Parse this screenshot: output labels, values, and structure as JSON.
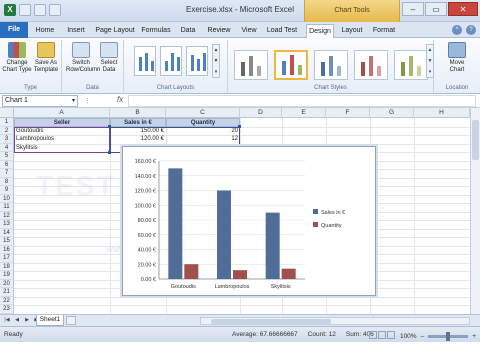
{
  "window": {
    "title": "Exercise.xlsx - Microsoft Excel",
    "context_tab_group": "Chart Tools"
  },
  "controls": {
    "minimize": "–",
    "restore": "▭",
    "close": "✕"
  },
  "tabs": [
    {
      "label": "File"
    },
    {
      "label": "Home"
    },
    {
      "label": "Insert"
    },
    {
      "label": "Page Layout"
    },
    {
      "label": "Formulas"
    },
    {
      "label": "Data"
    },
    {
      "label": "Review"
    },
    {
      "label": "View"
    },
    {
      "label": "Load Test"
    },
    {
      "label": "Design"
    },
    {
      "label": "Layout"
    },
    {
      "label": "Format"
    }
  ],
  "ribbon": {
    "change_chart_type": "Change Chart Type",
    "save_as_template": "Save As Template",
    "group_type": "Type",
    "switch_row_column": "Switch Row/Column",
    "select_data": "Select Data",
    "group_data": "Data",
    "group_chart_layouts": "Chart Layouts",
    "group_chart_styles": "Chart Styles",
    "move_chart": "Move Chart",
    "group_location": "Location"
  },
  "formula_bar": {
    "name_box": "Chart 1",
    "fx": "fx",
    "value": ""
  },
  "columns": [
    "A",
    "B",
    "C",
    "D",
    "E",
    "F",
    "G",
    "H"
  ],
  "rows": [
    "1",
    "2",
    "3",
    "4",
    "5",
    "6",
    "7",
    "8",
    "9",
    "10",
    "11",
    "12",
    "13",
    "14",
    "15",
    "16",
    "17",
    "18",
    "19",
    "20",
    "21",
    "22",
    "23"
  ],
  "table": {
    "headers": [
      "Seller",
      "Sales in €",
      "Quantity"
    ],
    "rows": [
      [
        "Goutoudis",
        "150.00 €",
        "20"
      ],
      [
        "Lambropoulos",
        "120.00 €",
        "12"
      ],
      [
        "Skylitsis",
        "",
        ""
      ]
    ]
  },
  "chart_data": {
    "type": "bar",
    "categories": [
      "Goutoudis",
      "Lambropoulos",
      "Skylitsis"
    ],
    "series": [
      {
        "name": "Sales in €",
        "values": [
          150,
          120,
          90
        ],
        "color": "#4f6d96"
      },
      {
        "name": "Quantity",
        "values": [
          20,
          12,
          14
        ],
        "color": "#a0504d"
      }
    ],
    "y_tick_labels": [
      "0.00 €",
      "20.00 €",
      "40.00 €",
      "60.00 €",
      "80.00 €",
      "100.00 €",
      "120.00 €",
      "140.00 €",
      "160.00 €"
    ],
    "ylim": [
      0,
      160
    ],
    "legend_position": "right",
    "grid": true
  },
  "watermark": {
    "text": "TEST 4U  DIPLOMA",
    "url": "www.test4u.eu   www.diploma.edu.gr"
  },
  "sheet": {
    "tab": "Sheet1"
  },
  "status": {
    "mode": "Ready",
    "average": "Average: 67.66666667",
    "count": "Count: 12",
    "sum": "Sum: 406",
    "zoom": "100%"
  }
}
